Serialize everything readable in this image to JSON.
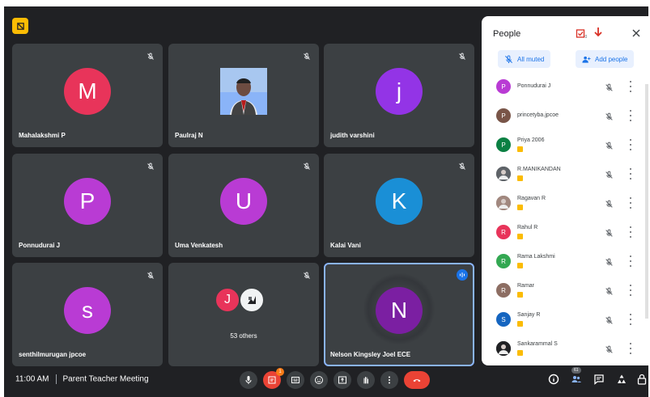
{
  "tiles": [
    {
      "name": "Mahalakshmi P",
      "initial": "M",
      "color": "#e8345a"
    },
    {
      "name": "Paulraj N",
      "initial": "",
      "color": "#8ab4f8",
      "photo": true
    },
    {
      "name": "judith varshini",
      "initial": "j",
      "color": "#9334e6"
    },
    {
      "name": "Ponnudurai J",
      "initial": "P",
      "color": "#b93bd4"
    },
    {
      "name": "Uma Venkatesh",
      "initial": "U",
      "color": "#b93bd4"
    },
    {
      "name": "Kalai Vani",
      "initial": "K",
      "color": "#1a8fd6"
    },
    {
      "name": "senthilmurugan jpcoe",
      "initial": "s",
      "color": "#b93bd4"
    },
    {
      "name": "",
      "others_label": "53 others",
      "initial": "J",
      "color": "#e8345a"
    },
    {
      "name": "Nelson Kingsley Joel ECE",
      "initial": "N",
      "color": "#7b1fa2"
    }
  ],
  "bottombar": {
    "time": "11:00 AM",
    "meeting_title": "Parent Teacher Meeting",
    "notif_count": "1",
    "people_count": "61",
    "controls": [
      "mic-icon",
      "present-notes-icon",
      "captions-icon",
      "emoji-icon",
      "present-icon",
      "raise-hand-icon",
      "more-icon",
      "end-call-icon"
    ],
    "right_controls": [
      "info-icon",
      "people-icon",
      "chat-icon",
      "activities-icon",
      "lock-icon"
    ]
  },
  "panel": {
    "title": "People",
    "task_count": "0",
    "all_muted": "All muted",
    "add_people": "Add people",
    "people": [
      {
        "name": "Ponnudurai J",
        "initial": "P",
        "color": "#b93bd4",
        "tag": false
      },
      {
        "name": "princetyba.jpcoe",
        "initial": "P",
        "color": "#795548",
        "tag": false
      },
      {
        "name": "Priya 2006",
        "initial": "P",
        "color": "#0b8043",
        "tag": true
      },
      {
        "name": "R.MANIKANDAN",
        "initial": "R",
        "color": "#5f6368",
        "tag": true,
        "photo": true
      },
      {
        "name": "Ragavan R",
        "initial": "R",
        "color": "#a1887f",
        "tag": true,
        "photo": true
      },
      {
        "name": "Rahul R",
        "initial": "R",
        "color": "#e8345a",
        "tag": true
      },
      {
        "name": "Rama Lakshmi",
        "initial": "R",
        "color": "#33a852",
        "tag": true
      },
      {
        "name": "Ramar",
        "initial": "R",
        "color": "#8d6e63",
        "tag": true
      },
      {
        "name": "Sanjay R",
        "initial": "S",
        "color": "#1565c0",
        "tag": true
      },
      {
        "name": "Sankarammal S",
        "initial": "S",
        "color": "#202124",
        "tag": true,
        "photo": true
      }
    ]
  }
}
